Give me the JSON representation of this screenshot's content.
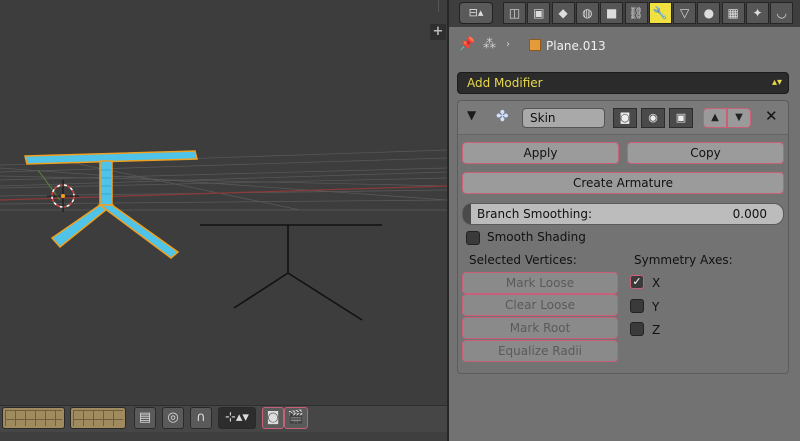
{
  "viewport": {
    "nav_plus": "+"
  },
  "viewport_header": {
    "icons": [
      "grid-layers-icon",
      "grid-layers-icon",
      "object-data-icon",
      "render-preview-icon",
      "snap-magnet-icon",
      "snap-target-icon",
      "render-camera-icon",
      "clapper-icon"
    ]
  },
  "properties": {
    "editor_selector_icon": "properties-editor-icon",
    "tabs": [
      {
        "name": "render",
        "glyph": "◫"
      },
      {
        "name": "render-layers",
        "glyph": "▣"
      },
      {
        "name": "scene",
        "glyph": "◆"
      },
      {
        "name": "world",
        "glyph": "◍"
      },
      {
        "name": "object",
        "glyph": "■"
      },
      {
        "name": "constraints",
        "glyph": "⛓"
      },
      {
        "name": "modifiers",
        "glyph": "🔧",
        "active": true
      },
      {
        "name": "data",
        "glyph": "▽"
      },
      {
        "name": "material",
        "glyph": "●"
      },
      {
        "name": "texture",
        "glyph": "▦"
      },
      {
        "name": "particles",
        "glyph": "✦"
      },
      {
        "name": "physics",
        "glyph": "◡"
      }
    ],
    "breadcrumb": {
      "object_name": "Plane.013",
      "separator": "›"
    },
    "add_modifier": {
      "label": "Add Modifier",
      "arrows": "▴▾"
    },
    "modifier": {
      "name": "Skin",
      "apply_label": "Apply",
      "copy_label": "Copy",
      "create_armature_label": "Create Armature",
      "branch_smoothing": {
        "label": "Branch Smoothing:",
        "value": "0.000"
      },
      "smooth_shading": {
        "label": "Smooth Shading",
        "checked": false
      },
      "selected_vertices": {
        "heading": "Selected Vertices:",
        "buttons": [
          "Mark Loose",
          "Clear Loose",
          "Mark Root",
          "Equalize Radii"
        ]
      },
      "symmetry": {
        "heading": "Symmetry Axes:",
        "axes": [
          {
            "label": "X",
            "checked": true
          },
          {
            "label": "Y",
            "checked": false
          },
          {
            "label": "Z",
            "checked": false
          }
        ]
      }
    }
  },
  "colors": {
    "accent_active_tab": "#f0e040",
    "mesh_skin": "#4fc3e8",
    "selection_outline": "#f0a020",
    "button_outline": "#c8607a",
    "add_modifier_text": "#e8d84a"
  }
}
